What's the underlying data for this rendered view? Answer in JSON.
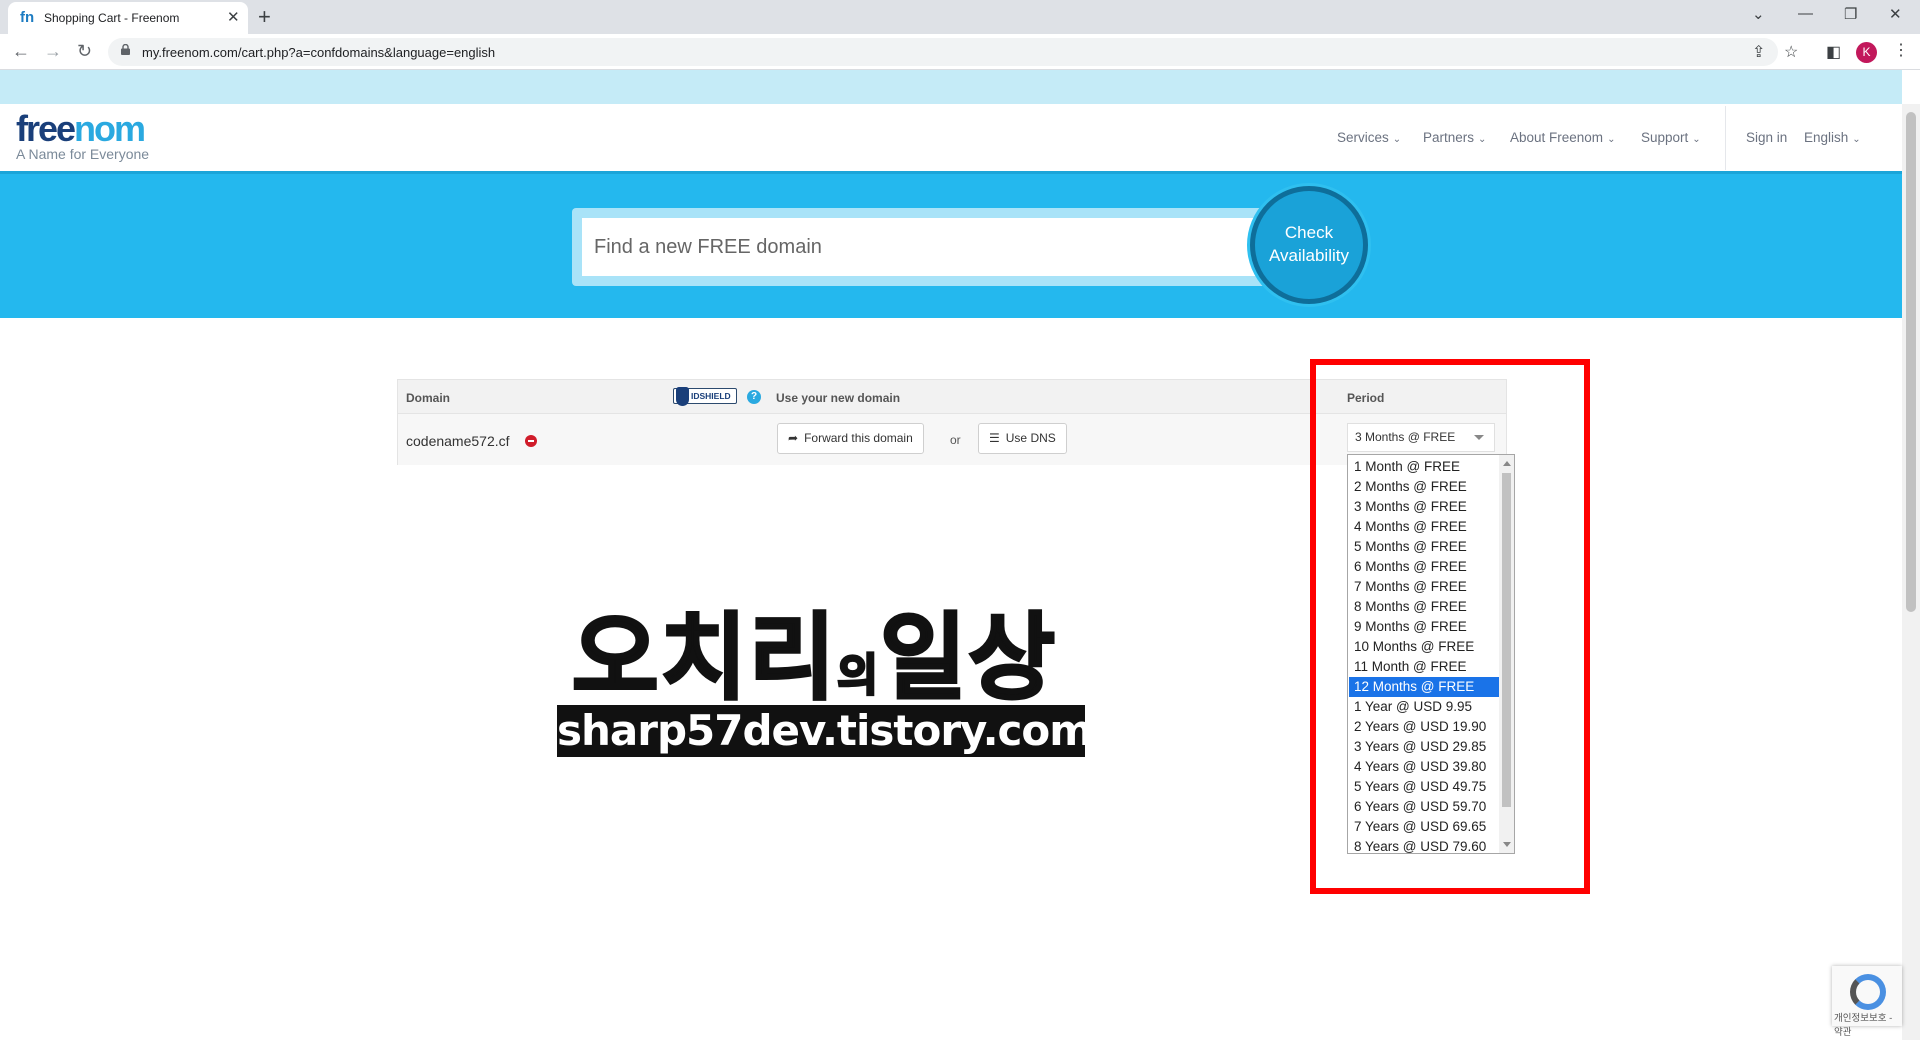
{
  "browser": {
    "tab_title": "Shopping Cart - Freenom",
    "tab_favicon": "fn",
    "url": "my.freenom.com/cart.php?a=confdomains&language=english",
    "profile_initial": "K"
  },
  "header": {
    "logo_free": "free",
    "logo_nom": "nom",
    "tagline": "A Name for Everyone",
    "nav": [
      "Services",
      "Partners",
      "About Freenom",
      "Support"
    ],
    "sign_in": "Sign in",
    "language": "English"
  },
  "hero": {
    "search_placeholder": "Find a new FREE domain",
    "check_line1": "Check",
    "check_line2": "Availability"
  },
  "cart": {
    "col_domain": "Domain",
    "idshield_label": "IDSHIELD",
    "help": "?",
    "col_use": "Use your new domain",
    "col_period": "Period",
    "domain": "codename572.cf",
    "forward_btn": "Forward this domain",
    "or": "or",
    "dns_btn": "Use DNS",
    "selected_period": "3 Months @ FREE"
  },
  "period_options": [
    "1 Month @ FREE",
    "2 Months @ FREE",
    "3 Months @ FREE",
    "4 Months @ FREE",
    "5 Months @ FREE",
    "6 Months @ FREE",
    "7 Months @ FREE",
    "8 Months @ FREE",
    "9 Months @ FREE",
    "10 Months @ FREE",
    "11 Month @ FREE",
    "12 Months @ FREE",
    "1 Year @ USD 9.95",
    "2 Years @ USD 19.90",
    "3 Years @ USD 29.85",
    "4 Years @ USD 39.80",
    "5 Years @ USD 49.75",
    "6 Years @ USD 59.70",
    "7 Years @ USD 69.65",
    "8 Years @ USD 79.60"
  ],
  "highlighted_option": "12 Months @ FREE",
  "watermark": {
    "title_a": "오치리",
    "title_b": "의",
    "title_c": "일상",
    "url": "sharp57dev.tistory.com"
  },
  "recaptcha_text": "개인정보보호 - 약관",
  "colors": {
    "brand_blue": "#24b8ee",
    "highlight": "#ff0000",
    "selected_option": "#1a73e8"
  }
}
